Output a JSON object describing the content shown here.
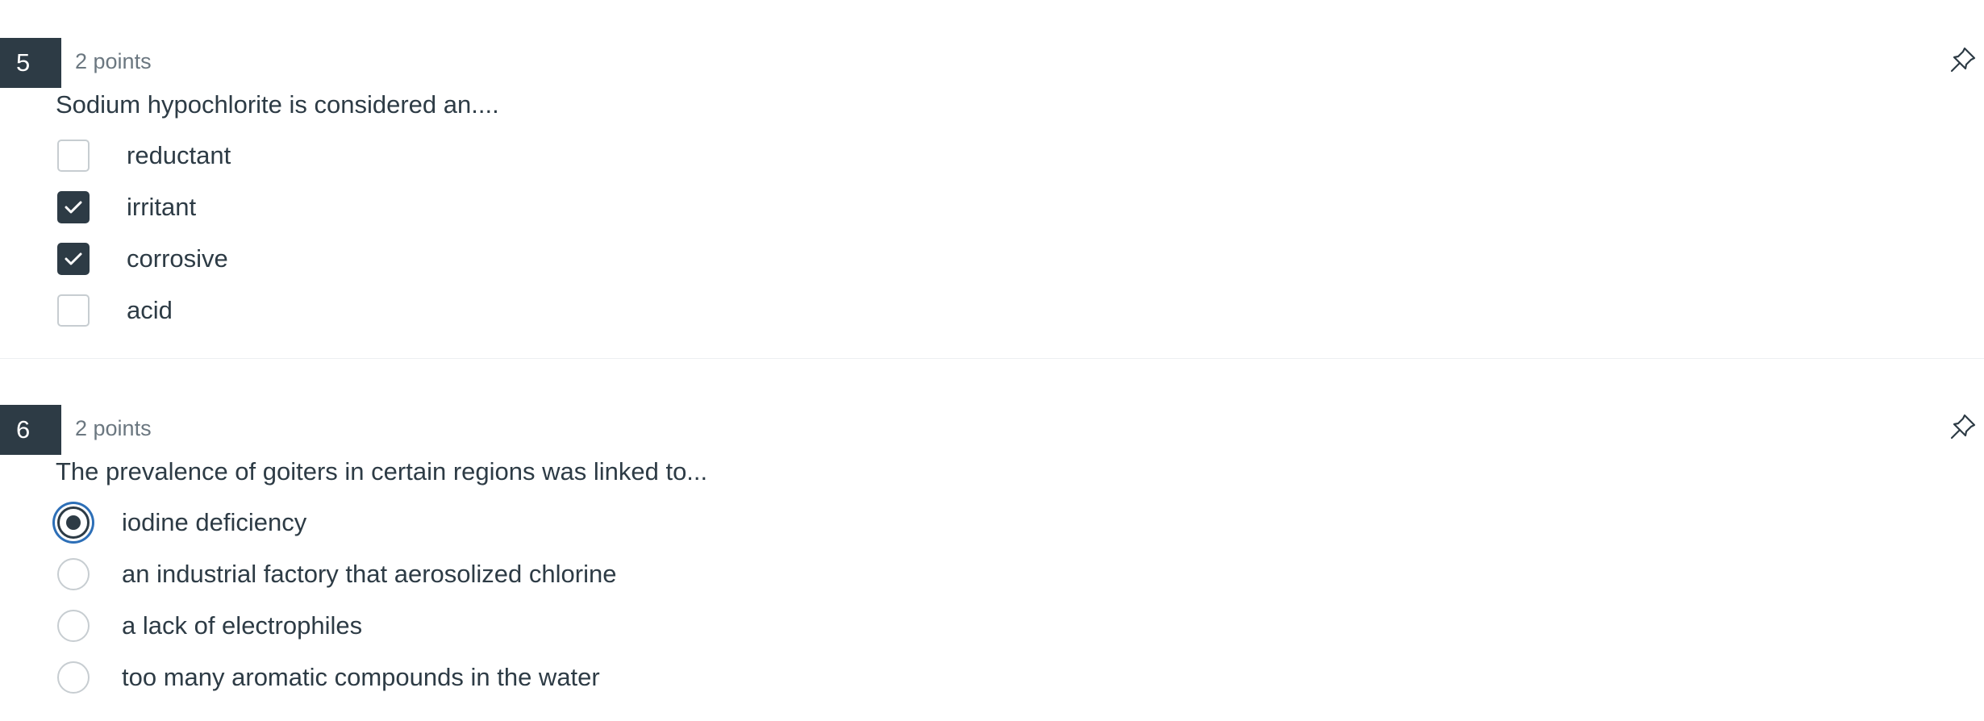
{
  "questions": [
    {
      "number": "5",
      "points": "2 points",
      "text": "Sodium hypochlorite is considered an....",
      "type": "checkbox",
      "answers": [
        {
          "label": "reductant",
          "checked": false
        },
        {
          "label": "irritant",
          "checked": true
        },
        {
          "label": "corrosive",
          "checked": true
        },
        {
          "label": "acid",
          "checked": false
        }
      ]
    },
    {
      "number": "6",
      "points": "2 points",
      "text": "The prevalence of goiters in certain regions was linked to...",
      "type": "radio",
      "answers": [
        {
          "label": "iodine deficiency",
          "selected": true
        },
        {
          "label": "an industrial factory that aerosolized chlorine",
          "selected": false
        },
        {
          "label": "a lack of electrophiles",
          "selected": false
        },
        {
          "label": "too many aromatic compounds in the water",
          "selected": false
        }
      ]
    }
  ],
  "icons": {
    "pin": "pin-icon",
    "checkmark": "checkmark-icon"
  },
  "colors": {
    "dark": "#2d3b45",
    "muted": "#6b7780",
    "focus": "#2d6fb7",
    "border": "#c7cdd1"
  }
}
